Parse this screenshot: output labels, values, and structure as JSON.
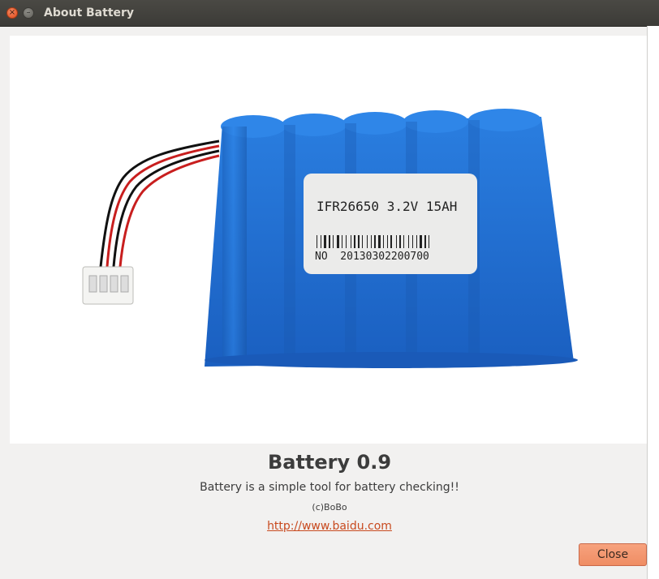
{
  "window": {
    "title": "About Battery",
    "close_glyph": "×",
    "minimize_glyph": "–"
  },
  "image": {
    "label_model": "IFR26650 3.2V 15AH",
    "label_serial": "NO  20130302200700",
    "pack_color": "#1f73d6"
  },
  "about": {
    "app_name": "Battery 0.9",
    "description": "Battery is a simple tool for battery checking!!",
    "copyright": "(c)BoBo",
    "link": "http://www.baidu.com"
  },
  "buttons": {
    "close_label": "Close"
  },
  "colors": {
    "accent": "#ef8d63",
    "link": "#c84a1f",
    "titlebar": "#3c3b37"
  },
  "icons": [
    "window-close-icon",
    "window-minimize-icon"
  ]
}
